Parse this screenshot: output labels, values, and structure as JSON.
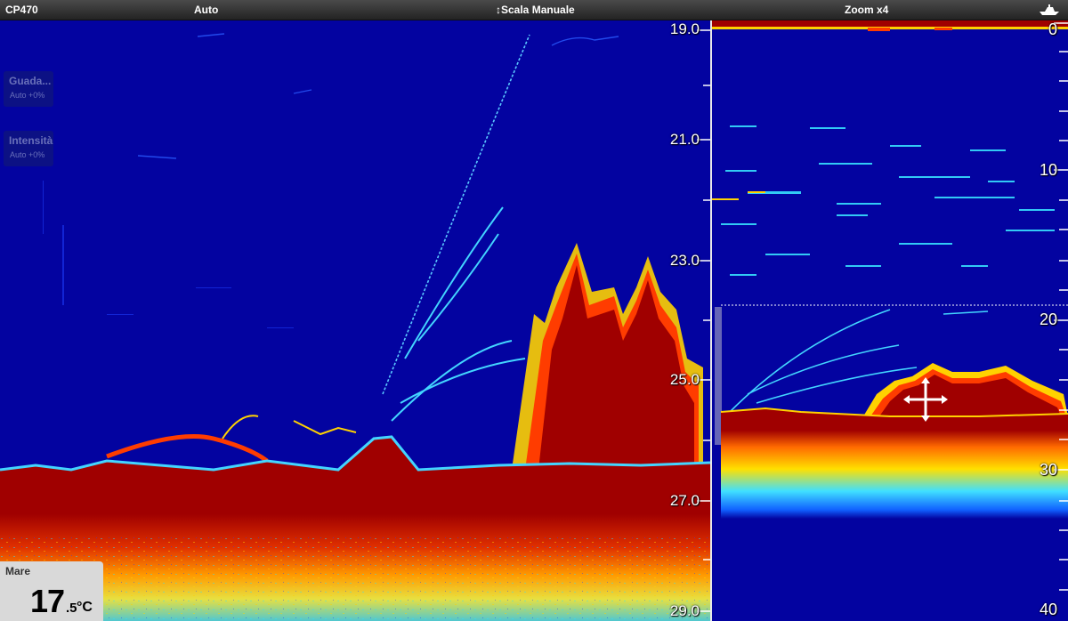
{
  "topbar": {
    "device": "CP470",
    "gain_mode": "Auto",
    "range_mode": "↕Scala Manuale",
    "zoom": "Zoom x4",
    "boat_icon": "boat-icon"
  },
  "left_panel": {
    "depth_scale": [
      "19.0",
      "21.0",
      "23.0",
      "25.0",
      "27.0",
      "29.0"
    ],
    "controls": [
      {
        "title": "Guada...",
        "value": "Auto +0%"
      },
      {
        "title": "Intensità",
        "value": "Auto +0%"
      }
    ],
    "temperature": {
      "title": "Mare",
      "integer": "17",
      "decimal": ".5",
      "unit": "°C"
    }
  },
  "right_panel": {
    "depth_scale": [
      "0",
      "10",
      "20",
      "30",
      "40"
    ],
    "cursor_icon": "move-cursor-icon"
  },
  "colors": {
    "water": "#0303a0",
    "bottom": "#a00000",
    "strong_return": "#ff3c00",
    "mid_return": "#ffd200",
    "weak_return": "#30e0ff",
    "topbar": "#2e2e2e"
  }
}
